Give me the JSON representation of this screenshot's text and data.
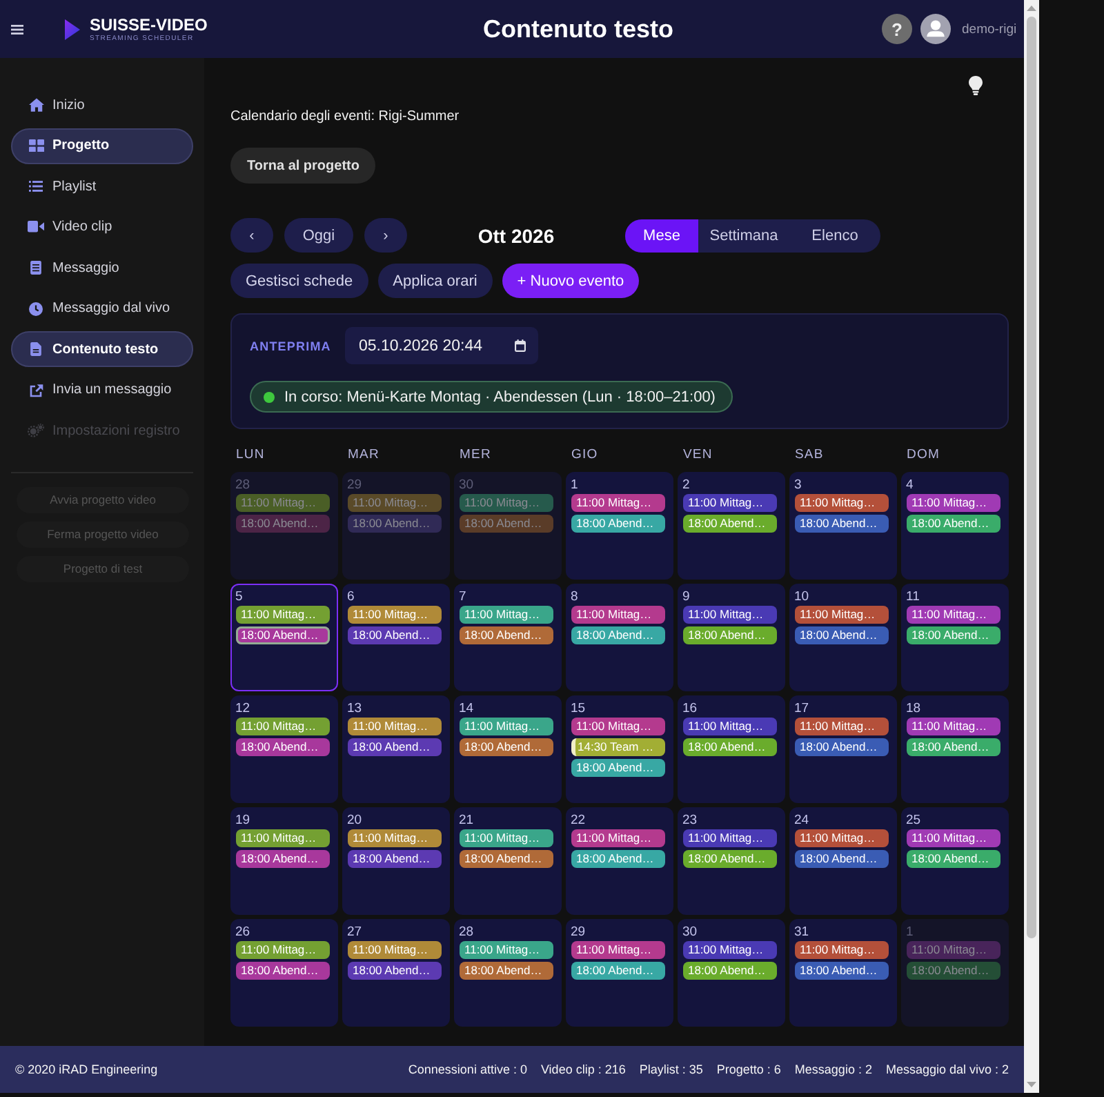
{
  "header": {
    "brand": "SUISSE-VIDEO",
    "brand_tagline": "STREAMING SCHEDULER",
    "title": "Contenuto testo",
    "help": "?",
    "user": "demo-rigi"
  },
  "sidebar": {
    "items": [
      {
        "label": "Inizio",
        "selected": false,
        "disabled": false
      },
      {
        "label": "Progetto",
        "selected": true,
        "disabled": false
      },
      {
        "label": "Playlist",
        "selected": false,
        "disabled": false
      },
      {
        "label": "Video clip",
        "selected": false,
        "disabled": false
      },
      {
        "label": "Messaggio",
        "selected": false,
        "disabled": false
      },
      {
        "label": "Messaggio dal vivo",
        "selected": false,
        "disabled": false
      },
      {
        "label": "Contenuto testo",
        "selected": true,
        "disabled": false
      },
      {
        "label": "Invia un messaggio",
        "selected": false,
        "disabled": false
      },
      {
        "label": "Impostazioni registro",
        "selected": false,
        "disabled": true
      }
    ],
    "actions": [
      {
        "label": "Avvia progetto video",
        "disabled": true
      },
      {
        "label": "Ferma progetto video",
        "disabled": true
      },
      {
        "label": "Progetto di test",
        "disabled": true
      }
    ]
  },
  "page": {
    "heading": "Calendario degli eventi: Rigi-Summer",
    "back_button": "Torna al progetto"
  },
  "calendar": {
    "toolbar": {
      "prev": "‹",
      "today": "Oggi",
      "next": "›",
      "period": "Ott 2026",
      "views": [
        {
          "label": "Mese",
          "selected": true
        },
        {
          "label": "Settimana",
          "selected": false
        },
        {
          "label": "Elenco",
          "selected": false
        }
      ]
    },
    "actions": [
      {
        "label": "Gestisci schede",
        "kind": "secondary"
      },
      {
        "label": "Applica orari",
        "kind": "secondary"
      },
      {
        "label": "+ Nuovo evento",
        "kind": "primary"
      }
    ],
    "preview": {
      "label": "ANTEPRIMA",
      "datetime": "05.10.2026 20:44",
      "status": "In corso: Menü-Karte Montag · Abendessen (Lun · 18:00–21:00)",
      "live": true
    },
    "weekdays": [
      "LUN",
      "MAR",
      "MER",
      "GIO",
      "VEN",
      "SAB",
      "DOM"
    ],
    "days": [
      {
        "number": "28",
        "outside": true,
        "today": false,
        "events": [
          {
            "text": "11:00 Mittag…",
            "color": "#4a5e26",
            "kind": "plain",
            "active": false
          },
          {
            "text": "18:00 Abend…",
            "color": "#4c2446",
            "kind": "plain",
            "active": false
          }
        ]
      },
      {
        "number": "29",
        "outside": true,
        "today": false,
        "events": [
          {
            "text": "11:00 Mittag…",
            "color": "#5a4a28",
            "kind": "plain",
            "active": false
          },
          {
            "text": "18:00 Abend…",
            "color": "#302a56",
            "kind": "plain",
            "active": false
          }
        ]
      },
      {
        "number": "30",
        "outside": true,
        "today": false,
        "events": [
          {
            "text": "11:00 Mittag…",
            "color": "#265a4c",
            "kind": "plain",
            "active": false
          },
          {
            "text": "18:00 Abend…",
            "color": "#5a3c28",
            "kind": "plain",
            "active": false
          }
        ]
      },
      {
        "number": "1",
        "outside": false,
        "today": false,
        "events": [
          {
            "text": "11:00 Mittag…",
            "color": "#b43a8e",
            "kind": "plain",
            "active": false
          },
          {
            "text": "18:00 Abend…",
            "color": "#38a8a4",
            "kind": "plain",
            "active": false
          }
        ]
      },
      {
        "number": "2",
        "outside": false,
        "today": false,
        "events": [
          {
            "text": "11:00 Mittag…",
            "color": "#4a3ab4",
            "kind": "plain",
            "active": false
          },
          {
            "text": "18:00 Abend…",
            "color": "#6aac2c",
            "kind": "plain",
            "active": false
          }
        ]
      },
      {
        "number": "3",
        "outside": false,
        "today": false,
        "events": [
          {
            "text": "11:00 Mittag…",
            "color": "#b4503a",
            "kind": "plain",
            "active": false
          },
          {
            "text": "18:00 Abend…",
            "color": "#3a5cb4",
            "kind": "plain",
            "active": false
          }
        ]
      },
      {
        "number": "4",
        "outside": false,
        "today": false,
        "events": [
          {
            "text": "11:00 Mittag…",
            "color": "#a03ab4",
            "kind": "plain",
            "active": false
          },
          {
            "text": "18:00 Abend…",
            "color": "#3aac6a",
            "kind": "plain",
            "active": false
          }
        ]
      },
      {
        "number": "5",
        "outside": false,
        "today": true,
        "events": [
          {
            "text": "11:00 Mittag…",
            "color": "#74a032",
            "kind": "plain",
            "active": false
          },
          {
            "text": "18:00 Abend…",
            "color": "#a8389c",
            "kind": "plain",
            "active": true
          }
        ]
      },
      {
        "number": "6",
        "outside": false,
        "today": false,
        "events": [
          {
            "text": "11:00 Mittag…",
            "color": "#b08a38",
            "kind": "plain",
            "active": false
          },
          {
            "text": "18:00 Abend…",
            "color": "#5c3ab2",
            "kind": "plain",
            "active": false
          }
        ]
      },
      {
        "number": "7",
        "outside": false,
        "today": false,
        "events": [
          {
            "text": "11:00 Mittag…",
            "color": "#3aa68a",
            "kind": "plain",
            "active": false
          },
          {
            "text": "18:00 Abend…",
            "color": "#b06a38",
            "kind": "plain",
            "active": false
          }
        ]
      },
      {
        "number": "8",
        "outside": false,
        "today": false,
        "events": [
          {
            "text": "11:00 Mittag…",
            "color": "#b43a8e",
            "kind": "plain",
            "active": false
          },
          {
            "text": "18:00 Abend…",
            "color": "#38a8a4",
            "kind": "plain",
            "active": false
          }
        ]
      },
      {
        "number": "9",
        "outside": false,
        "today": false,
        "events": [
          {
            "text": "11:00 Mittag…",
            "color": "#4a3ab4",
            "kind": "plain",
            "active": false
          },
          {
            "text": "18:00 Abend…",
            "color": "#6aac2c",
            "kind": "plain",
            "active": false
          }
        ]
      },
      {
        "number": "10",
        "outside": false,
        "today": false,
        "events": [
          {
            "text": "11:00 Mittag…",
            "color": "#b4503a",
            "kind": "plain",
            "active": false
          },
          {
            "text": "18:00 Abend…",
            "color": "#3a5cb4",
            "kind": "plain",
            "active": false
          }
        ]
      },
      {
        "number": "11",
        "outside": false,
        "today": false,
        "events": [
          {
            "text": "11:00 Mittag…",
            "color": "#a03ab4",
            "kind": "plain",
            "active": false
          },
          {
            "text": "18:00 Abend…",
            "color": "#3aac6a",
            "kind": "plain",
            "active": false
          }
        ]
      },
      {
        "number": "12",
        "outside": false,
        "today": false,
        "events": [
          {
            "text": "11:00 Mittag…",
            "color": "#74a032",
            "kind": "plain",
            "active": false
          },
          {
            "text": "18:00 Abend…",
            "color": "#a8389c",
            "kind": "plain",
            "active": false
          }
        ]
      },
      {
        "number": "13",
        "outside": false,
        "today": false,
        "events": [
          {
            "text": "11:00 Mittag…",
            "color": "#b08a38",
            "kind": "plain",
            "active": false
          },
          {
            "text": "18:00 Abend…",
            "color": "#5c3ab2",
            "kind": "plain",
            "active": false
          }
        ]
      },
      {
        "number": "14",
        "outside": false,
        "today": false,
        "events": [
          {
            "text": "11:00 Mittag…",
            "color": "#3aa68a",
            "kind": "plain",
            "active": false
          },
          {
            "text": "18:00 Abend…",
            "color": "#b06a38",
            "kind": "plain",
            "active": false
          }
        ]
      },
      {
        "number": "15",
        "outside": false,
        "today": false,
        "events": [
          {
            "text": "11:00 Mittag…",
            "color": "#b43a8e",
            "kind": "plain",
            "active": false
          },
          {
            "text": "14:30 Team …",
            "color": "#a2ae34",
            "kind": "flagged",
            "active": false
          },
          {
            "text": "18:00 Abend…",
            "color": "#38a8a4",
            "kind": "plain",
            "active": false
          }
        ]
      },
      {
        "number": "16",
        "outside": false,
        "today": false,
        "events": [
          {
            "text": "11:00 Mittag…",
            "color": "#4a3ab4",
            "kind": "plain",
            "active": false
          },
          {
            "text": "18:00 Abend…",
            "color": "#6aac2c",
            "kind": "plain",
            "active": false
          }
        ]
      },
      {
        "number": "17",
        "outside": false,
        "today": false,
        "events": [
          {
            "text": "11:00 Mittag…",
            "color": "#b4503a",
            "kind": "plain",
            "active": false
          },
          {
            "text": "18:00 Abend…",
            "color": "#3a5cb4",
            "kind": "plain",
            "active": false
          }
        ]
      },
      {
        "number": "18",
        "outside": false,
        "today": false,
        "events": [
          {
            "text": "11:00 Mittag…",
            "color": "#a03ab4",
            "kind": "plain",
            "active": false
          },
          {
            "text": "18:00 Abend…",
            "color": "#3aac6a",
            "kind": "plain",
            "active": false
          }
        ]
      },
      {
        "number": "19",
        "outside": false,
        "today": false,
        "events": [
          {
            "text": "11:00 Mittag…",
            "color": "#74a032",
            "kind": "plain",
            "active": false
          },
          {
            "text": "18:00 Abend…",
            "color": "#a8389c",
            "kind": "plain",
            "active": false
          }
        ]
      },
      {
        "number": "20",
        "outside": false,
        "today": false,
        "events": [
          {
            "text": "11:00 Mittag…",
            "color": "#b08a38",
            "kind": "plain",
            "active": false
          },
          {
            "text": "18:00 Abend…",
            "color": "#5c3ab2",
            "kind": "plain",
            "active": false
          }
        ]
      },
      {
        "number": "21",
        "outside": false,
        "today": false,
        "events": [
          {
            "text": "11:00 Mittag…",
            "color": "#3aa68a",
            "kind": "plain",
            "active": false
          },
          {
            "text": "18:00 Abend…",
            "color": "#b06a38",
            "kind": "plain",
            "active": false
          }
        ]
      },
      {
        "number": "22",
        "outside": false,
        "today": false,
        "events": [
          {
            "text": "11:00 Mittag…",
            "color": "#b43a8e",
            "kind": "plain",
            "active": false
          },
          {
            "text": "18:00 Abend…",
            "color": "#38a8a4",
            "kind": "plain",
            "active": false
          }
        ]
      },
      {
        "number": "23",
        "outside": false,
        "today": false,
        "events": [
          {
            "text": "11:00 Mittag…",
            "color": "#4a3ab4",
            "kind": "plain",
            "active": false
          },
          {
            "text": "18:00 Abend…",
            "color": "#6aac2c",
            "kind": "plain",
            "active": false
          }
        ]
      },
      {
        "number": "24",
        "outside": false,
        "today": false,
        "events": [
          {
            "text": "11:00 Mittag…",
            "color": "#b4503a",
            "kind": "plain",
            "active": false
          },
          {
            "text": "18:00 Abend…",
            "color": "#3a5cb4",
            "kind": "plain",
            "active": false
          }
        ]
      },
      {
        "number": "25",
        "outside": false,
        "today": false,
        "events": [
          {
            "text": "11:00 Mittag…",
            "color": "#a03ab4",
            "kind": "plain",
            "active": false
          },
          {
            "text": "18:00 Abend…",
            "color": "#3aac6a",
            "kind": "plain",
            "active": false
          }
        ]
      },
      {
        "number": "26",
        "outside": false,
        "today": false,
        "events": [
          {
            "text": "11:00 Mittag…",
            "color": "#74a032",
            "kind": "plain",
            "active": false
          },
          {
            "text": "18:00 Abend…",
            "color": "#a8389c",
            "kind": "plain",
            "active": false
          }
        ]
      },
      {
        "number": "27",
        "outside": false,
        "today": false,
        "events": [
          {
            "text": "11:00 Mittag…",
            "color": "#b08a38",
            "kind": "plain",
            "active": false
          },
          {
            "text": "18:00 Abend…",
            "color": "#5c3ab2",
            "kind": "plain",
            "active": false
          }
        ]
      },
      {
        "number": "28",
        "outside": false,
        "today": false,
        "events": [
          {
            "text": "11:00 Mittag…",
            "color": "#3aa68a",
            "kind": "plain",
            "active": false
          },
          {
            "text": "18:00 Abend…",
            "color": "#b06a38",
            "kind": "plain",
            "active": false
          }
        ]
      },
      {
        "number": "29",
        "outside": false,
        "today": false,
        "events": [
          {
            "text": "11:00 Mittag…",
            "color": "#b43a8e",
            "kind": "plain",
            "active": false
          },
          {
            "text": "18:00 Abend…",
            "color": "#38a8a4",
            "kind": "plain",
            "active": false
          }
        ]
      },
      {
        "number": "30",
        "outside": false,
        "today": false,
        "events": [
          {
            "text": "11:00 Mittag…",
            "color": "#4a3ab4",
            "kind": "plain",
            "active": false
          },
          {
            "text": "18:00 Abend…",
            "color": "#6aac2c",
            "kind": "plain",
            "active": false
          }
        ]
      },
      {
        "number": "31",
        "outside": false,
        "today": false,
        "events": [
          {
            "text": "11:00 Mittag…",
            "color": "#b4503a",
            "kind": "plain",
            "active": false
          },
          {
            "text": "18:00 Abend…",
            "color": "#3a5cb4",
            "kind": "plain",
            "active": false
          }
        ]
      },
      {
        "number": "1",
        "outside": true,
        "today": false,
        "events": [
          {
            "text": "11:00 Mittag…",
            "color": "#48245a",
            "kind": "plain",
            "active": false
          },
          {
            "text": "18:00 Abend…",
            "color": "#244e36",
            "kind": "plain",
            "active": false
          }
        ]
      }
    ]
  },
  "footer": {
    "copyright": "© 2020 iRAD Engineering",
    "stats": [
      "Connessioni attive : 0",
      "Video clip : 216",
      "Playlist : 35",
      "Progetto : 6",
      "Messaggio : 2",
      "Messaggio dal vivo : 2"
    ]
  }
}
